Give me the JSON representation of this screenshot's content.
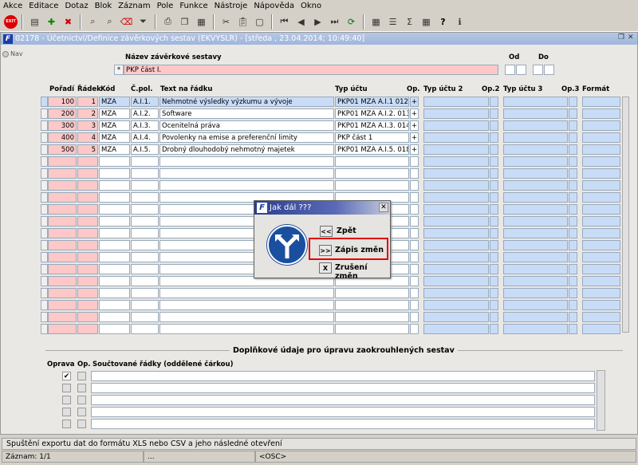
{
  "menu": [
    "Akce",
    "Editace",
    "Dotaz",
    "Blok",
    "Záznam",
    "Pole",
    "Funkce",
    "Nástroje",
    "Nápověda",
    "Okno"
  ],
  "toolbar": {
    "exit_label": "EXIT"
  },
  "window": {
    "title": "02178 - Účetnictví/Definice závěrkových sestav (EKVYSLR) - [středa , 23.04.2014; 10:49:40]",
    "nav_label": "Nav"
  },
  "header": {
    "name_label": "Název závěrkové sestavy",
    "name_value": "PKP část I.",
    "od_label": "Od",
    "do_label": "Do"
  },
  "columns": {
    "poradi": "Pořadí",
    "radek": "Řádek",
    "kod": "Kód",
    "cpol": "Č.pol.",
    "text": "Text na řádku",
    "typ": "Typ účtu",
    "op": "Op.",
    "typ2": "Typ účtu 2",
    "op2": "Op.2",
    "typ3": "Typ účtu 3",
    "op3": "Op.3",
    "format": "Formát"
  },
  "rows": [
    {
      "poradi": "100",
      "radek": "1",
      "kod": "MZA",
      "cpol": "A.I.1.",
      "text": "Nehmotné výsledky výzkumu a vývoje",
      "typ": "PKP01 MZA A.I.1 012",
      "op": "+"
    },
    {
      "poradi": "200",
      "radek": "2",
      "kod": "MZA",
      "cpol": "A.I.2.",
      "text": "Software",
      "typ": "PKP01 MZA A.I.2. 013",
      "op": "+"
    },
    {
      "poradi": "300",
      "radek": "3",
      "kod": "MZA",
      "cpol": "A.I.3.",
      "text": "Ocenitelná práva",
      "typ": "PKP01 MZA A.I.3. 014",
      "op": "+"
    },
    {
      "poradi": "400",
      "radek": "4",
      "kod": "MZA",
      "cpol": "A.I.4.",
      "text": "Povolenky na emise a preferenční limity",
      "typ": "PKP část 1",
      "op": "+"
    },
    {
      "poradi": "500",
      "radek": "5",
      "kod": "MZA",
      "cpol": "A.I.5.",
      "text": "Drobný dlouhodobý nehmotný majetek",
      "typ": "PKP01 MZA A.I.5. 018",
      "op": "+"
    }
  ],
  "extra": {
    "title": "Doplňkové údaje pro úpravu zaokrouhlených sestav",
    "col_oprava": "Oprava",
    "col_op": "Op.",
    "col_soucet": "Součtované řádky (oddělené čárkou)"
  },
  "dialog": {
    "title": "Jak dál ???",
    "back_key": "<<",
    "back_label": "Zpět",
    "save_key": ">>",
    "save_label": "Zápis změn",
    "cancel_key": "X",
    "cancel_label": "Zrušení změn"
  },
  "status": {
    "message": "Spuštění exportu dat do formátu XLS nebo CSV a jeho následné otevření",
    "record": "Záznam: 1/1",
    "dots": "...",
    "osc": "<OSC>"
  }
}
